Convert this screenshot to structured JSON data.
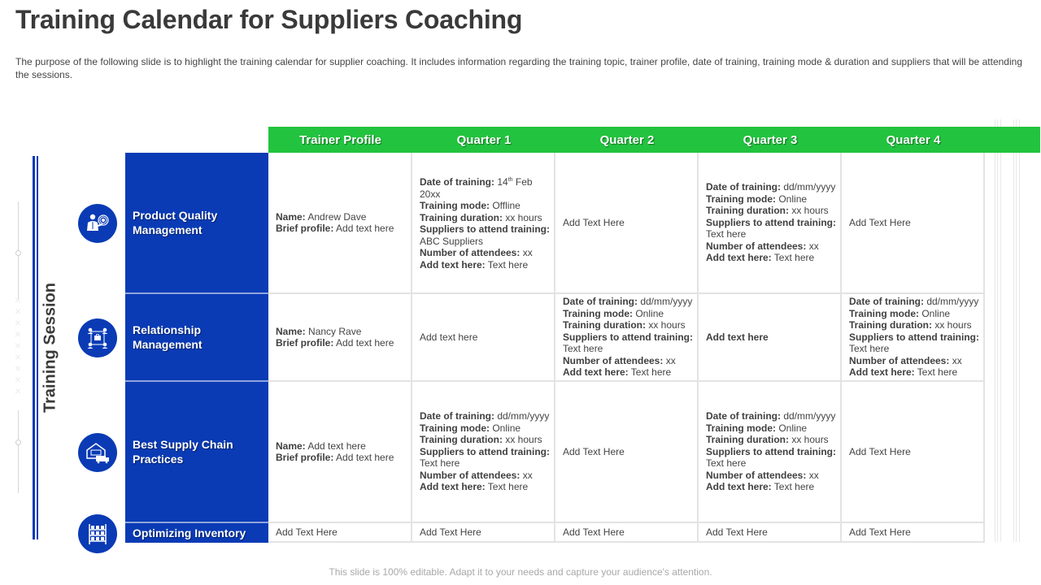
{
  "title": "Training Calendar for Suppliers Coaching",
  "description": "The purpose of the following slide is to highlight the training calendar for supplier coaching. It includes information regarding the training topic, trainer profile, date of training, training mode & duration and suppliers that will be attending the sessions.",
  "side_label": "Training Session",
  "colors": {
    "header_green": "#22c33e",
    "topic_blue": "#0a3bb5"
  },
  "columns": [
    "Trainer Profile",
    "Quarter 1",
    "Quarter 2",
    "Quarter 3",
    "Quarter 4"
  ],
  "rows": [
    {
      "topic": "Product Quality Management",
      "icon": "manager-target-icon",
      "cells": [
        {
          "lines": [
            {
              "label": "Name:",
              "value": " Andrew Dave"
            },
            {
              "label": "Brief profile:",
              "value": " Add text here"
            }
          ]
        },
        {
          "lines": [
            {
              "label": "Date of training:",
              "value": " 14",
              "sup": "th",
              "value2": " Feb 20xx"
            },
            {
              "label": "Training mode:",
              "value": " Offline"
            },
            {
              "label": "Training duration:",
              "value": " xx hours"
            },
            {
              "label": "Suppliers to attend training:",
              "value": " ABC Suppliers"
            },
            {
              "label": "Number of attendees:",
              "value": " xx"
            },
            {
              "label": "Add text here:",
              "value": " Text here"
            }
          ]
        },
        {
          "text": "Add Text Here"
        },
        {
          "lines": [
            {
              "label": "Date of training:",
              "value": " dd/mm/yyyy"
            },
            {
              "label": "Training mode:",
              "value": " Online"
            },
            {
              "label": "Training duration:",
              "value": " xx hours"
            },
            {
              "label": "Suppliers to attend training:",
              "value": " Text here"
            },
            {
              "label": "Number of attendees:",
              "value": " xx"
            },
            {
              "label": "Add text here:",
              "value": " Text here"
            }
          ]
        },
        {
          "text": "Add Text Here"
        }
      ]
    },
    {
      "topic": "Relationship Management",
      "icon": "team-network-icon",
      "cells": [
        {
          "lines": [
            {
              "label": "Name:",
              "value": " Nancy Rave"
            },
            {
              "label": "Brief profile:",
              "value": " Add text here"
            }
          ]
        },
        {
          "text": "Add text here"
        },
        {
          "lines": [
            {
              "label": "Date of training:",
              "value": " dd/mm/yyyy"
            },
            {
              "label": "Training mode:",
              "value": " Online"
            },
            {
              "label": "Training duration:",
              "value": " xx hours"
            },
            {
              "label": "Suppliers to attend training:",
              "value": " Text here"
            },
            {
              "label": "Number of attendees:",
              "value": " xx"
            },
            {
              "label": "Add text here:",
              "value": " Text here"
            }
          ]
        },
        {
          "bold_text": "Add text here"
        },
        {
          "lines": [
            {
              "label": "Date of training:",
              "value": " dd/mm/yyyy"
            },
            {
              "label": "Training mode:",
              "value": " Online"
            },
            {
              "label": "Training duration:",
              "value": " xx hours"
            },
            {
              "label": "Suppliers to attend training:",
              "value": " Text here"
            },
            {
              "label": "Number of attendees:",
              "value": " xx"
            },
            {
              "label": "Add text here:",
              "value": " Text here"
            }
          ]
        }
      ]
    },
    {
      "topic": "Best Supply Chain Practices",
      "icon": "warehouse-truck-icon",
      "cells": [
        {
          "lines": [
            {
              "label": "Name:",
              "value": " Add text here"
            },
            {
              "label": "Brief profile:",
              "value": " Add text here"
            }
          ]
        },
        {
          "lines": [
            {
              "label": "Date of training:",
              "value": " dd/mm/yyyy"
            },
            {
              "label": "Training mode:",
              "value": " Online"
            },
            {
              "label": "Training duration:",
              "value": " xx hours"
            },
            {
              "label": "Suppliers to attend training:",
              "value": " Text here"
            },
            {
              "label": "Number of attendees:",
              "value": " xx"
            },
            {
              "label": "Add text here:",
              "value": " Text here"
            }
          ]
        },
        {
          "text": "Add Text Here"
        },
        {
          "lines": [
            {
              "label": "Date of training:",
              "value": " dd/mm/yyyy"
            },
            {
              "label": "Training mode:",
              "value": " Online"
            },
            {
              "label": "Training duration:",
              "value": " xx hours"
            },
            {
              "label": "Suppliers to attend training:",
              "value": " Text here"
            },
            {
              "label": "Number of attendees:",
              "value": " xx"
            },
            {
              "label": "Add text here:",
              "value": " Text here"
            }
          ]
        },
        {
          "text": "Add Text Here"
        }
      ]
    },
    {
      "topic": "Optimizing Inventory",
      "icon": "inventory-shelf-icon",
      "cells": [
        {
          "text": "Add Text Here"
        },
        {
          "text": "Add Text Here"
        },
        {
          "text": "Add Text Here"
        },
        {
          "text": "Add Text Here"
        },
        {
          "text": "Add Text Here"
        }
      ]
    }
  ],
  "footer": "This slide is 100% editable. Adapt it to your needs and capture your audience's attention."
}
